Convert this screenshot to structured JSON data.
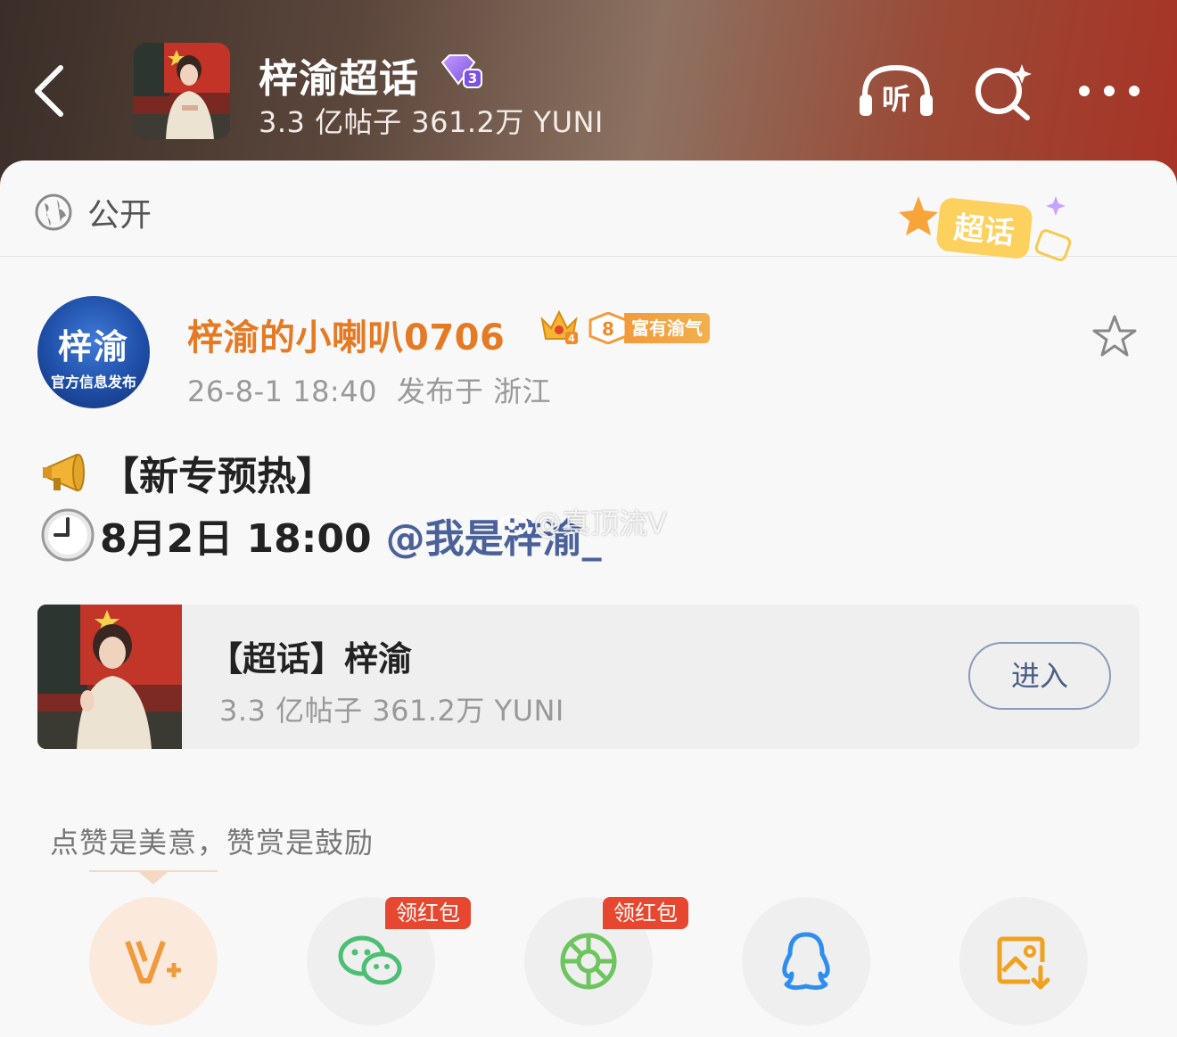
{
  "header": {
    "topic_title": "梓渝超话",
    "badge_level": "3",
    "topic_stats": "3.3 亿帖子 361.2万 YUNI",
    "listen_label": "听"
  },
  "visibility": {
    "label": "公开",
    "sticker_text": "超话"
  },
  "post": {
    "author_avatar_line1": "梓渝",
    "author_avatar_line2": "官方信息发布",
    "author_name": "梓渝的小喇叭0706",
    "crown_level": "4",
    "level_number": "8",
    "level_title": "富有渝气",
    "date": "26-8-1 18:40",
    "location": "发布于 浙江",
    "line1_text": "【新专预热】",
    "line2_time": "8月2日 18:00",
    "line2_mention": "@我是梓渝_",
    "watermark": "@真顶流V"
  },
  "topic_card": {
    "title": "【超话】梓渝",
    "stats": "3.3 亿帖子 361.2万 YUNI",
    "enter_label": "进入"
  },
  "share": {
    "reward_text": "点赞是美意，赞赏是鼓励",
    "hongbao_label": "领红包",
    "colors": {
      "vplus": "#f09a3e",
      "wechat": "#4cbf74",
      "moments": "#6ec45f",
      "qq": "#2e8ef0",
      "save": "#f0a21f"
    }
  }
}
